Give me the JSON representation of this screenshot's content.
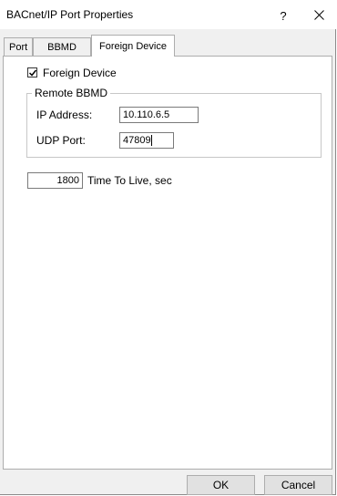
{
  "window": {
    "title": "BACnet/IP Port Properties",
    "help_label": "?",
    "close_icon": "close-icon"
  },
  "tabs": [
    {
      "label": "Port",
      "selected": false
    },
    {
      "label": "BBMD",
      "selected": false
    },
    {
      "label": "Foreign Device",
      "selected": true
    }
  ],
  "foreign_device": {
    "checkbox_label": "Foreign Device",
    "checked": true,
    "remote_bbmd": {
      "legend": "Remote BBMD",
      "ip_label": "IP Address:",
      "ip_value": "10.110.6.5",
      "udp_label": "UDP Port:",
      "udp_value": "47809"
    },
    "ttl_value": "1800",
    "ttl_label": "Time To Live, sec"
  },
  "buttons": {
    "ok": "OK",
    "cancel": "Cancel"
  }
}
